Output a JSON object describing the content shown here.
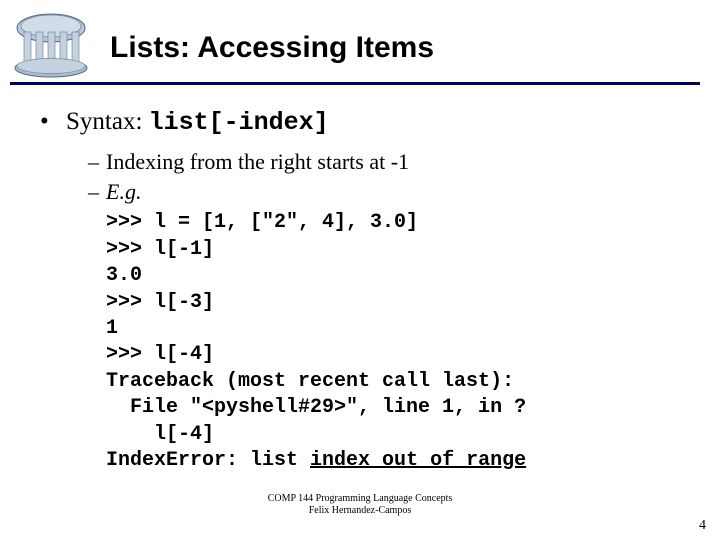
{
  "title": "Lists: Accessing Items",
  "syntax": {
    "label": "Syntax: ",
    "code": "list[-index]"
  },
  "sub1": "Indexing from the right starts at -1",
  "sub2": "E.g.",
  "code_lines": {
    "l0": ">>> l = [1, [\"2\", 4], 3.0]",
    "l1": ">>> l[-1]",
    "l2": "3.0",
    "l3": ">>> l[-3]",
    "l4": "1",
    "l5": ">>> l[-4]",
    "l6": "Traceback (most recent call last):",
    "l7": "  File \"<pyshell#29>\", line 1, in ?",
    "l8": "    l[-4]",
    "l9_a": "IndexError: list ",
    "l9_b": "index out of range"
  },
  "footer": {
    "line1": "COMP 144 Programming Language Concepts",
    "line2": "Felix Hernandez-Campos"
  },
  "page_number": "4"
}
